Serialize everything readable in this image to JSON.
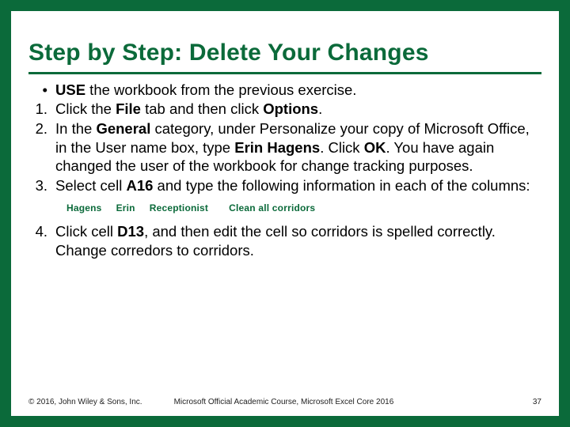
{
  "title": "Step by Step: Delete Your Changes",
  "items": [
    {
      "marker": "•",
      "segments": [
        {
          "bold": true,
          "text": "USE"
        },
        {
          "bold": false,
          "text": " the workbook from the previous exercise."
        }
      ]
    },
    {
      "marker": "1.",
      "segments": [
        {
          "bold": false,
          "text": "Click the "
        },
        {
          "bold": true,
          "text": "File"
        },
        {
          "bold": false,
          "text": " tab and then click "
        },
        {
          "bold": true,
          "text": "Options"
        },
        {
          "bold": false,
          "text": "."
        }
      ]
    },
    {
      "marker": "2.",
      "segments": [
        {
          "bold": false,
          "text": "In the "
        },
        {
          "bold": true,
          "text": "General"
        },
        {
          "bold": false,
          "text": " category, under Personalize your copy of Microsoft Office, in the User name box, type "
        },
        {
          "bold": true,
          "text": "Erin Hagens"
        },
        {
          "bold": false,
          "text": ". Click "
        },
        {
          "bold": true,
          "text": "OK"
        },
        {
          "bold": false,
          "text": ". You have again changed the user of the workbook for change tracking purposes."
        }
      ]
    },
    {
      "marker": "3.",
      "segments": [
        {
          "bold": false,
          "text": "Select cell "
        },
        {
          "bold": true,
          "text": "A16"
        },
        {
          "bold": false,
          "text": " and type the following information in each of the columns:"
        }
      ]
    }
  ],
  "table_row": {
    "c1": "Hagens",
    "c2": "Erin",
    "c3": "Receptionist",
    "c4": "Clean all corridors"
  },
  "item4": {
    "marker": "4.",
    "segments": [
      {
        "bold": false,
        "text": "Click cell "
      },
      {
        "bold": true,
        "text": "D13"
      },
      {
        "bold": false,
        "text": ", and then edit the cell so corridors is spelled correctly. Change corredors to corridors."
      }
    ]
  },
  "footer": {
    "left": "© 2016, John Wiley & Sons, Inc.",
    "center": "Microsoft Official Academic Course, Microsoft Excel Core 2016",
    "right": "37"
  }
}
